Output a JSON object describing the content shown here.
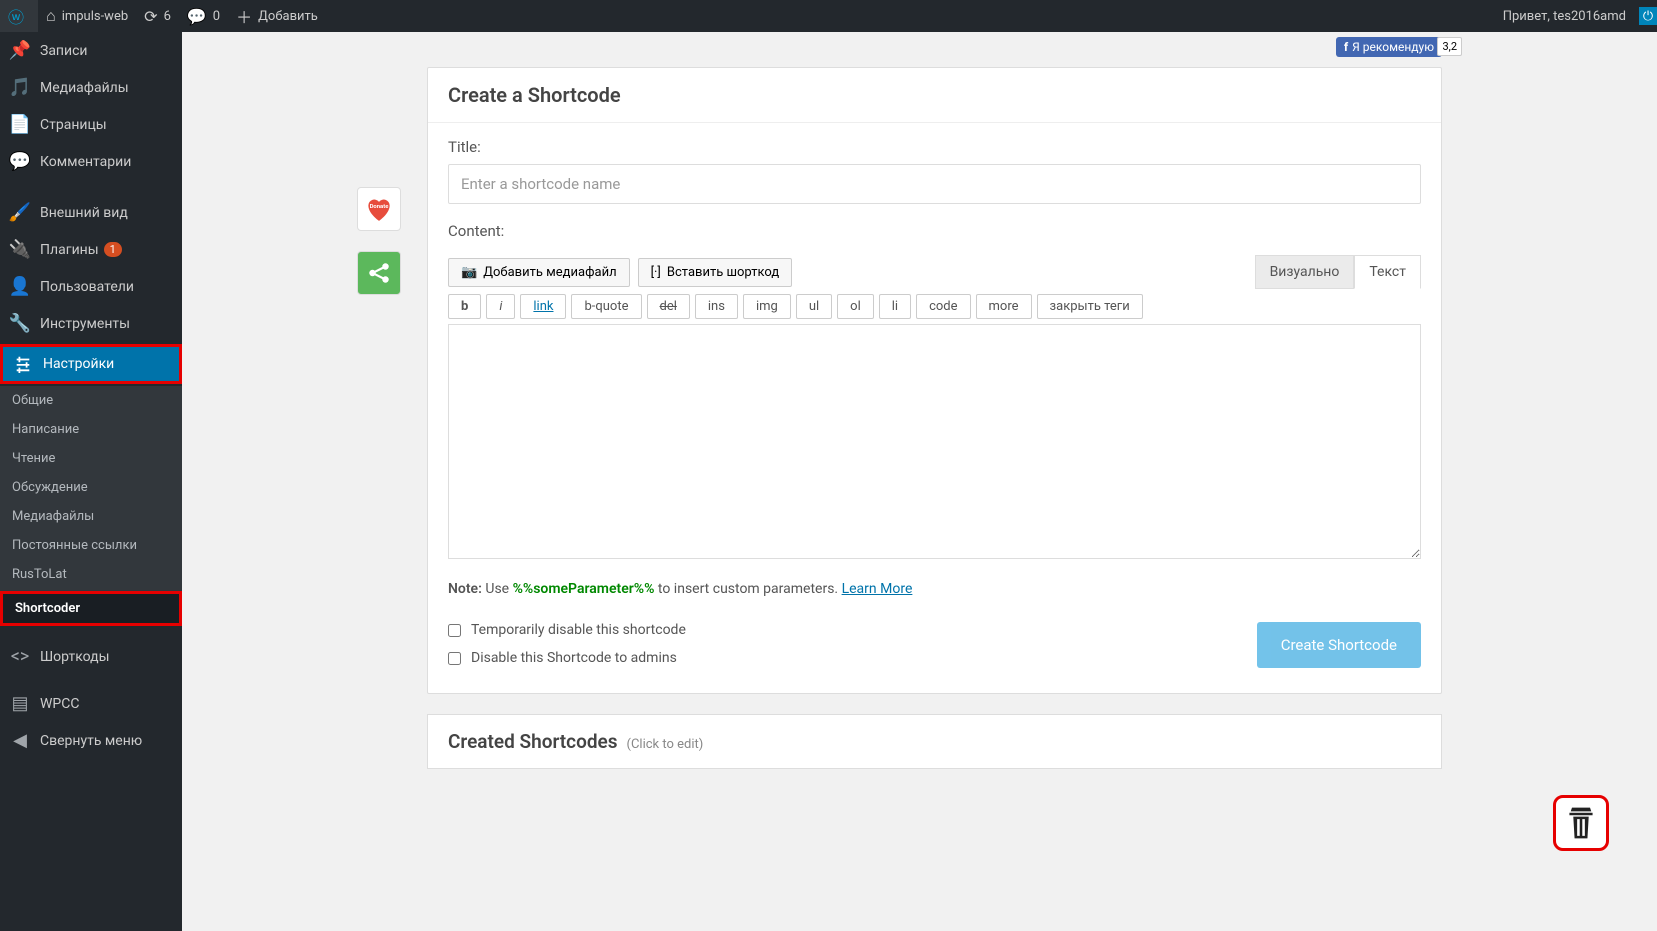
{
  "adminbar": {
    "site_name": "impuls-web",
    "updates_count": "6",
    "comments_count": "0",
    "add_new": "Добавить",
    "greeting": "Привет, tes2016amd"
  },
  "sidebar": {
    "items": [
      {
        "label": "Записи",
        "icon": "pin"
      },
      {
        "label": "Медиафайлы",
        "icon": "media"
      },
      {
        "label": "Страницы",
        "icon": "page"
      },
      {
        "label": "Комментарии",
        "icon": "comment"
      },
      {
        "label": "Внешний вид",
        "icon": "brush"
      },
      {
        "label": "Плагины",
        "icon": "plug",
        "badge": "1"
      },
      {
        "label": "Пользователи",
        "icon": "user"
      },
      {
        "label": "Инструменты",
        "icon": "wrench"
      },
      {
        "label": "Настройки",
        "icon": "settings",
        "active": true
      },
      {
        "label": "Шорткоды",
        "icon": "code"
      },
      {
        "label": "WPCC",
        "icon": "wpcc"
      }
    ],
    "submenu": [
      "Общие",
      "Написание",
      "Чтение",
      "Обсуждение",
      "Медиафайлы",
      "Постоянные ссылки",
      "RusToLat",
      "Shortcoder"
    ],
    "collapse": "Свернуть меню"
  },
  "fb": {
    "label": "Я рекомендую",
    "count": "3,2"
  },
  "panel": {
    "title": "Create a Shortcode",
    "title_label": "Title:",
    "title_placeholder": "Enter a shortcode name",
    "content_label": "Content:",
    "add_media": "Добавить медиафайл",
    "insert_shortcode": "Вставить шорткод",
    "tab_visual": "Визуально",
    "tab_text": "Текст",
    "qt": [
      "b",
      "i",
      "link",
      "b-quote",
      "del",
      "ins",
      "img",
      "ul",
      "ol",
      "li",
      "code",
      "more",
      "закрыть теги"
    ],
    "note_bold": "Note:",
    "note_use": " Use ",
    "note_param": "%%someParameter%%",
    "note_rest": " to insert custom parameters. ",
    "note_link": "Learn More",
    "cb1": "Temporarily disable this shortcode",
    "cb2": "Disable this Shortcode to admins",
    "create_btn": "Create Shortcode"
  },
  "panel2": {
    "title": "Created Shortcodes",
    "hint": "(Click to edit)"
  }
}
